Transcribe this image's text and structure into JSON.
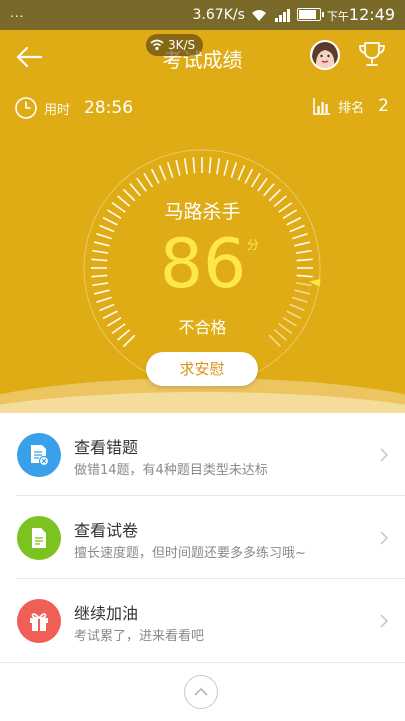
{
  "status_bar": {
    "dots": "...",
    "speed": "3.67K/s",
    "ampm": "下午",
    "time": "12:49",
    "floating_speed": "3K/S"
  },
  "header": {
    "title": "考试成绩"
  },
  "stats": {
    "time_label": "用时",
    "time_value": "28:56",
    "rank_label": "排名",
    "rank_value": "2"
  },
  "result": {
    "skill_title": "马路杀手",
    "score": "86",
    "score_unit": "分",
    "verdict": "不合格",
    "comfort_button": "求安慰"
  },
  "list": [
    {
      "title": "查看错题",
      "subtitle": "做错14题，有4种题目类型未达标",
      "icon": "wrong-questions-icon",
      "color": "#3aa0ea"
    },
    {
      "title": "查看试卷",
      "subtitle": "擅长速度题，但时间题还要多多练习哦~",
      "icon": "paper-icon",
      "color": "#7cc221"
    },
    {
      "title": "继续加油",
      "subtitle": "考试累了，进来看看吧",
      "icon": "gift-icon",
      "color": "#ef5e57"
    }
  ],
  "colors": {
    "hero_bg": "#e0ac16",
    "score_color": "#fde74c",
    "button_text": "#d9941a"
  }
}
